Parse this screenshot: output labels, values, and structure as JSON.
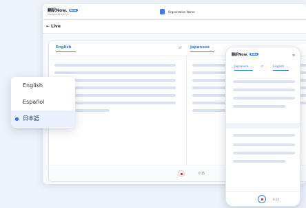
{
  "app": {
    "logo_title": "翻訳Now.",
    "logo_badge": "Beta",
    "logo_subtitle": "Powered by NICT/PI",
    "org_name": "Organization Name",
    "back_icon": "back-icon",
    "live_label": "Live"
  },
  "panel": {
    "source_lang": "English",
    "target_lang": "Japanese",
    "swap_icon": "swap-icon",
    "timer": "0:15"
  },
  "dropdown": {
    "options": [
      {
        "label": "English",
        "selected": false
      },
      {
        "label": "Español",
        "selected": false
      },
      {
        "label": "日本語",
        "selected": true
      }
    ]
  },
  "phone": {
    "logo_title": "翻訳Now.",
    "logo_badge": "Beta",
    "source_lang": "Japanese",
    "target_lang": "English",
    "menu_icon": "hamburger-icon",
    "timer": "0:15"
  },
  "colors": {
    "accent": "#2f79f0",
    "record": "#e02d2d",
    "background": "#eef3f9",
    "placeholder_line": "#d9e2ee"
  }
}
